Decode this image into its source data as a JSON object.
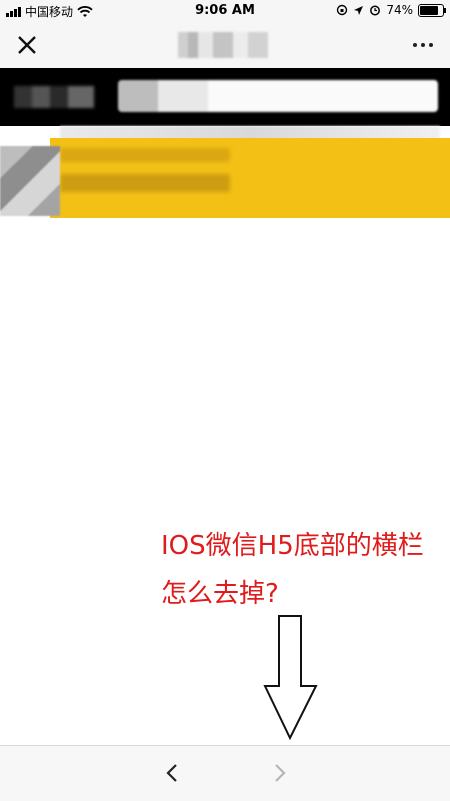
{
  "status_bar": {
    "carrier": "中国移动",
    "time": "9:06 AM",
    "battery": "74%",
    "battery_level": 0.74
  },
  "nav": {
    "close_icon": "close-icon",
    "more_icon": "more-icon"
  },
  "annotation": {
    "line1": "IOS微信H5底部的横栏",
    "line2": "怎么去掉?"
  },
  "bottom_bar": {
    "back_icon": "chevron-left-icon",
    "forward_icon": "chevron-right-icon"
  },
  "colors": {
    "annotation": "#e01b1b",
    "banner": "#f3c115",
    "header_band": "#000000",
    "forward_disabled": "#b5b5b5"
  }
}
